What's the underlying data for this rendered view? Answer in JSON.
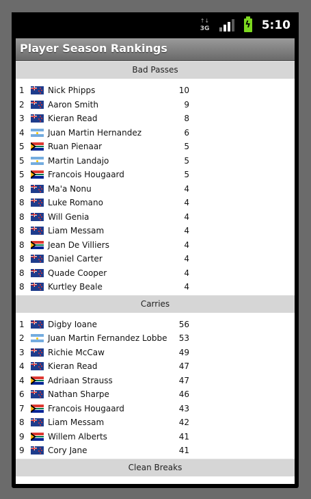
{
  "status": {
    "network": "3G",
    "time": "5:10"
  },
  "app": {
    "title": "Player Season Rankings"
  },
  "sections": [
    {
      "title": "Bad Passes",
      "rows": [
        {
          "rank": "1",
          "flag": "nz",
          "name": "Nick Phipps",
          "value": "10"
        },
        {
          "rank": "2",
          "flag": "nz",
          "name": "Aaron Smith",
          "value": "9"
        },
        {
          "rank": "3",
          "flag": "nz",
          "name": "Kieran Read",
          "value": "8"
        },
        {
          "rank": "4",
          "flag": "ar",
          "name": "Juan Martin Hernandez",
          "value": "6"
        },
        {
          "rank": "5",
          "flag": "za",
          "name": "Ruan Pienaar",
          "value": "5"
        },
        {
          "rank": "5",
          "flag": "ar",
          "name": "Martin Landajo",
          "value": "5"
        },
        {
          "rank": "5",
          "flag": "za",
          "name": "Francois Hougaard",
          "value": "5"
        },
        {
          "rank": "8",
          "flag": "nz",
          "name": "Ma'a Nonu",
          "value": "4"
        },
        {
          "rank": "8",
          "flag": "nz",
          "name": "Luke Romano",
          "value": "4"
        },
        {
          "rank": "8",
          "flag": "nz",
          "name": "Will Genia",
          "value": "4"
        },
        {
          "rank": "8",
          "flag": "nz",
          "name": "Liam Messam",
          "value": "4"
        },
        {
          "rank": "8",
          "flag": "za",
          "name": "Jean De Villiers",
          "value": "4"
        },
        {
          "rank": "8",
          "flag": "nz",
          "name": "Daniel Carter",
          "value": "4"
        },
        {
          "rank": "8",
          "flag": "nz",
          "name": "Quade Cooper",
          "value": "4"
        },
        {
          "rank": "8",
          "flag": "nz",
          "name": "Kurtley Beale",
          "value": "4"
        }
      ]
    },
    {
      "title": "Carries",
      "rows": [
        {
          "rank": "1",
          "flag": "nz",
          "name": "Digby Ioane",
          "value": "56"
        },
        {
          "rank": "2",
          "flag": "ar",
          "name": "Juan Martin Fernandez Lobbe",
          "value": "53"
        },
        {
          "rank": "3",
          "flag": "nz",
          "name": "Richie McCaw",
          "value": "49"
        },
        {
          "rank": "4",
          "flag": "nz",
          "name": "Kieran Read",
          "value": "47"
        },
        {
          "rank": "4",
          "flag": "za",
          "name": "Adriaan Strauss",
          "value": "47"
        },
        {
          "rank": "6",
          "flag": "nz",
          "name": "Nathan Sharpe",
          "value": "46"
        },
        {
          "rank": "7",
          "flag": "za",
          "name": "Francois Hougaard",
          "value": "43"
        },
        {
          "rank": "8",
          "flag": "nz",
          "name": "Liam Messam",
          "value": "42"
        },
        {
          "rank": "9",
          "flag": "za",
          "name": "Willem Alberts",
          "value": "41"
        },
        {
          "rank": "9",
          "flag": "nz",
          "name": "Cory Jane",
          "value": "41"
        }
      ]
    },
    {
      "title": "Clean Breaks",
      "rows": []
    }
  ]
}
